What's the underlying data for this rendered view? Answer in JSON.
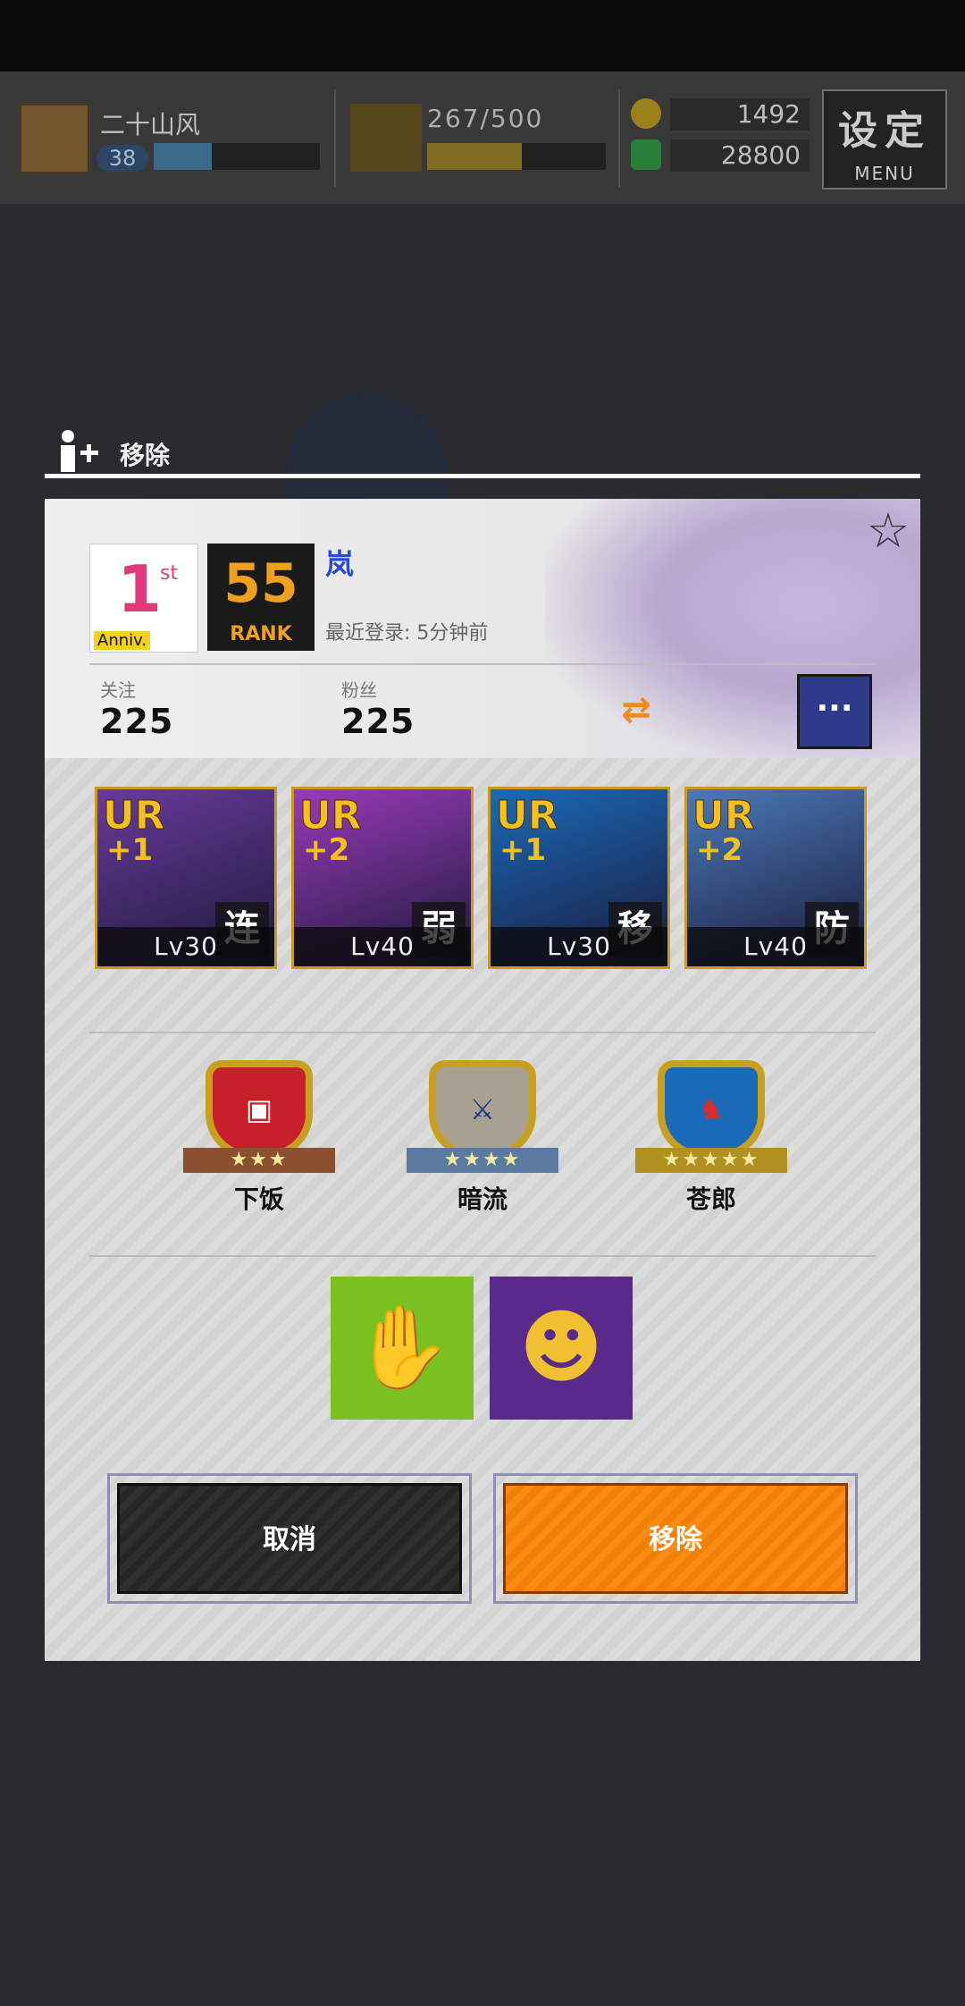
{
  "topbar": {
    "player_name": "二十山风",
    "player_level": "38",
    "xp_fraction": 0.35,
    "stamina_text": "267/500",
    "stamina_fraction": 0.53,
    "coins": "1492",
    "gems": "28800",
    "menu_big": "设定",
    "menu_small": "MENU"
  },
  "dialog": {
    "header_label": "移除",
    "profile": {
      "anniv_number": "1",
      "anniv_suffix": "st",
      "anniv_text": "Anniv.",
      "rank_number": "55",
      "rank_label": "RANK",
      "name": "岚",
      "last_login": "最近登录:  5分钟前",
      "following_label": "关注",
      "following_count": "225",
      "fans_label": "粉丝",
      "fans_count": "225",
      "swap_icon": "⇄",
      "more_label": "···"
    },
    "cards": [
      {
        "rarity": "UR",
        "plus": "+1",
        "tag": "连",
        "level": "Lv30",
        "color": "#6a3a9a"
      },
      {
        "rarity": "UR",
        "plus": "+2",
        "tag": "弱",
        "level": "Lv40",
        "color": "#9a3ab8"
      },
      {
        "rarity": "UR",
        "plus": "+1",
        "tag": "移",
        "level": "Lv30",
        "color": "#1a6ab8"
      },
      {
        "rarity": "UR",
        "plus": "+2",
        "tag": "防",
        "level": "Lv40",
        "color": "#4a7ab8"
      }
    ],
    "emblems": [
      {
        "label": "下饭",
        "stars": "★★★",
        "icon": "tv-icon",
        "ribbon_color": "#8a5030"
      },
      {
        "label": "暗流",
        "stars": "★★★★",
        "icon": "crossed-swords-icon",
        "ribbon_color": "#5a7aa0"
      },
      {
        "label": "苍郎",
        "stars": "★★★★★",
        "icon": "dragon-icon",
        "ribbon_color": "#b09020"
      }
    ],
    "skills": [
      {
        "icon": "hand-eye-icon",
        "bg": "#7ac020"
      },
      {
        "icon": "masked-face-icon",
        "bg": "#5a2a8a"
      }
    ],
    "cancel_label": "取消",
    "remove_label": "移除"
  }
}
